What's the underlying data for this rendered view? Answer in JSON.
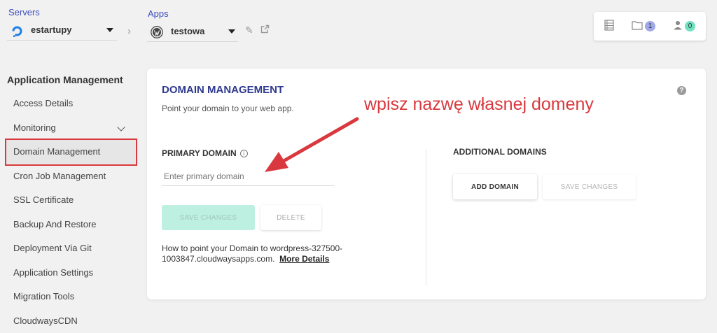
{
  "servers": {
    "label": "Servers",
    "value": "estartupy",
    "icon": "digitalocean-logo-icon"
  },
  "apps": {
    "label": "Apps",
    "value": "testowa",
    "icon": "wordpress-logo-icon"
  },
  "top_right": {
    "files_badge": "1",
    "users_badge": "0",
    "files_badge_color": "#9fa8e8",
    "users_badge_color": "#6fe1c0"
  },
  "sidebar": {
    "title": "Application Management",
    "items": [
      {
        "label": "Access Details"
      },
      {
        "label": "Monitoring"
      },
      {
        "label": "Domain Management"
      },
      {
        "label": "Cron Job Management"
      },
      {
        "label": "SSL Certificate"
      },
      {
        "label": "Backup And Restore"
      },
      {
        "label": "Deployment Via Git"
      },
      {
        "label": "Application Settings"
      },
      {
        "label": "Migration Tools"
      },
      {
        "label": "CloudwaysCDN"
      }
    ]
  },
  "main": {
    "title": "DOMAIN MANAGEMENT",
    "subtitle": "Point your domain to your web app.",
    "annotation": "wpisz nazwę własnej domeny",
    "primary": {
      "label": "PRIMARY DOMAIN",
      "placeholder": "Enter primary domain",
      "save_label": "SAVE CHANGES",
      "delete_label": "DELETE"
    },
    "additional": {
      "label": "ADDITIONAL DOMAINS",
      "add_label": "ADD DOMAIN",
      "save_label": "SAVE CHANGES"
    },
    "howto_text": "How to point your Domain to wordpress-327500-1003847.cloudwaysapps.com.",
    "howto_link": "More Details"
  },
  "colors": {
    "accent": "#3c4dbd",
    "annotation": "#d9393e",
    "save_disabled": "#bdf0e0"
  }
}
